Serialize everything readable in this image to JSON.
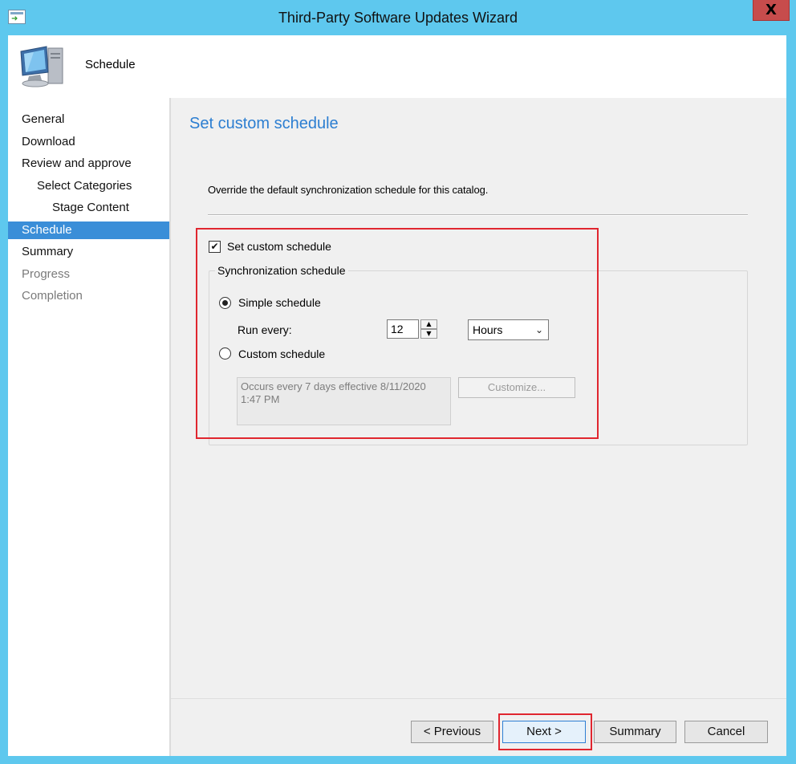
{
  "window": {
    "title": "Third-Party Software Updates Wizard",
    "close_label": "X"
  },
  "header": {
    "title": "Schedule",
    "icon": "computer-icon"
  },
  "nav": {
    "items": [
      {
        "label": "General",
        "state": "normal"
      },
      {
        "label": "Download",
        "state": "normal"
      },
      {
        "label": "Review and approve",
        "state": "normal"
      },
      {
        "label": "Select Categories",
        "state": "normal"
      },
      {
        "label": "Stage Content",
        "state": "normal"
      },
      {
        "label": "Schedule",
        "state": "selected"
      },
      {
        "label": "Summary",
        "state": "normal"
      },
      {
        "label": "Progress",
        "state": "disabled"
      },
      {
        "label": "Completion",
        "state": "disabled"
      }
    ]
  },
  "main": {
    "heading": "Set custom schedule",
    "description": "Override the default synchronization schedule for this catalog.",
    "custom_schedule_checkbox": {
      "label": "Set custom schedule",
      "checked": true
    },
    "group_label": "Synchronization schedule",
    "simple_schedule": {
      "label": "Simple schedule",
      "selected": true
    },
    "run_every_label": "Run every:",
    "run_every_value": "12",
    "unit": {
      "selected": "Hours"
    },
    "custom_schedule": {
      "label": "Custom schedule",
      "selected": false
    },
    "schedule_description": "Occurs every 7 days effective 8/11/2020 1:47 PM",
    "customize_label": "Customize..."
  },
  "footer": {
    "previous_label": "< Previous",
    "next_label": "Next >",
    "summary_label": "Summary",
    "cancel_label": "Cancel"
  },
  "colors": {
    "accent": "#2c7ed1",
    "selection": "#3a8ed8",
    "highlight": "#e0262f",
    "frame": "#5ec8ee"
  }
}
